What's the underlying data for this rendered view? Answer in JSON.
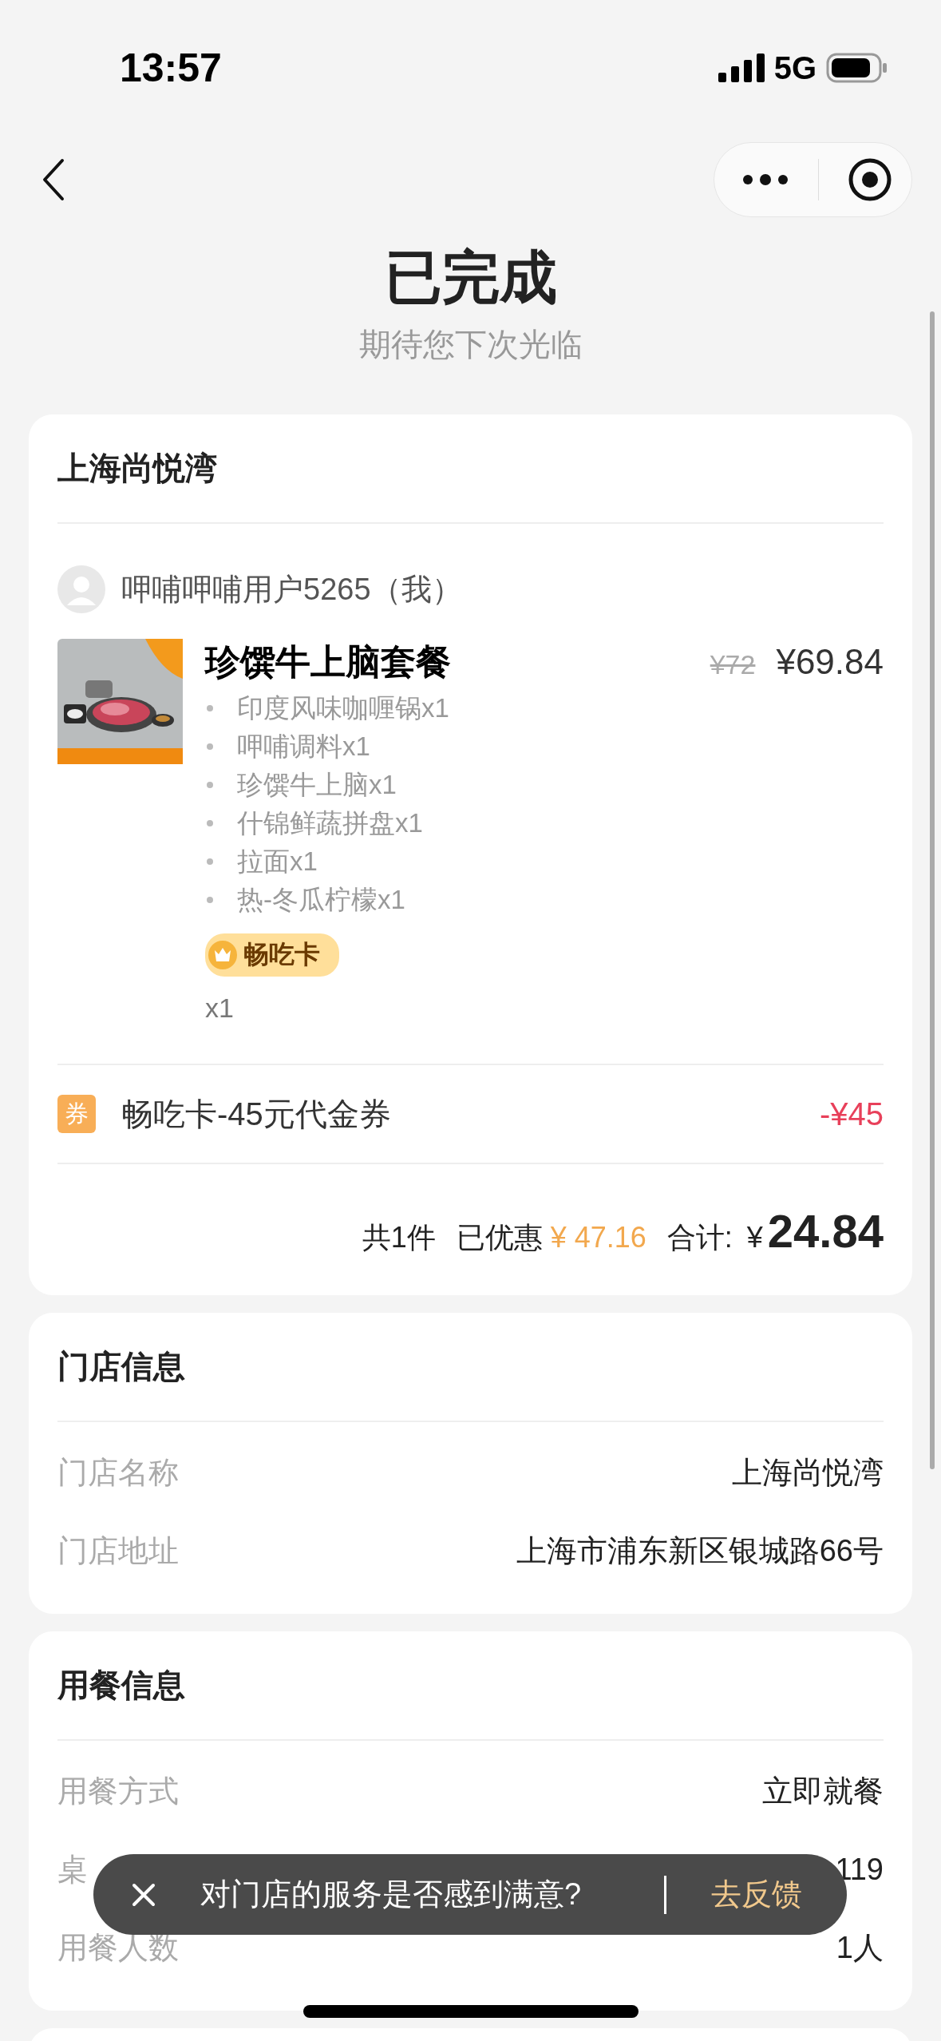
{
  "status_bar": {
    "time": "13:57",
    "network": "5G"
  },
  "header": {
    "title": "已完成",
    "subtitle": "期待您下次光临"
  },
  "order": {
    "store": "上海尚悦湾",
    "user": "呷哺呷哺用户5265（我）",
    "product": {
      "kind": "picture",
      "name": "珍馔牛上脑套餐",
      "original_price": "¥72",
      "price": "¥69.84",
      "items": [
        "印度风味咖喱锅x1",
        "呷哺调料x1",
        "珍馔牛上脑x1",
        "什锦鲜蔬拼盘x1",
        "拉面x1",
        "热-冬瓜柠檬x1"
      ],
      "card_badge": "畅吃卡",
      "quantity": "x1"
    },
    "coupon": {
      "icon": "券",
      "label": "畅吃卡-45元代金券",
      "amount": "-¥45"
    },
    "summary": {
      "count": "共1件",
      "discount_label": "已优惠",
      "discount": "¥ 47.16",
      "total_label": "合计:",
      "currency": "¥",
      "total": "24.84"
    }
  },
  "store_info": {
    "title": "门店信息",
    "rows": [
      {
        "label": "门店名称",
        "value": "上海尚悦湾"
      },
      {
        "label": "门店地址",
        "value": "上海市浦东新区银城路66号"
      }
    ]
  },
  "dining_info": {
    "title": "用餐信息",
    "rows": [
      {
        "label": "用餐方式",
        "value": "立即就餐"
      },
      {
        "label": "桌",
        "value": "119"
      },
      {
        "label": "用餐人数",
        "value": "1人"
      }
    ]
  },
  "toast": {
    "message": "对门店的服务是否感到满意?",
    "action": "去反馈"
  }
}
